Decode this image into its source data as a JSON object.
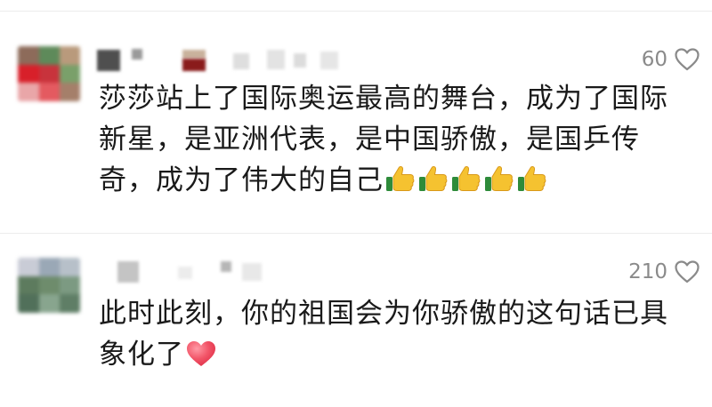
{
  "comments": [
    {
      "like_count": "60",
      "text": "莎莎站上了国际奥运最高的舞台，成为了国际新星，是亚洲代表，是中国骄傲，是国乒传奇，成为了伟大的自己",
      "emojis": [
        "thumbs-up",
        "thumbs-up",
        "thumbs-up",
        "thumbs-up",
        "thumbs-up"
      ]
    },
    {
      "like_count": "210",
      "text": "此时此刻，你的祖国会为你骄傲的这句话已具象化了",
      "emojis": [
        "red-heart"
      ]
    }
  ],
  "colors": {
    "like_count": "#8a8a8a",
    "text": "#1a1a1a",
    "divider": "#ececec"
  }
}
